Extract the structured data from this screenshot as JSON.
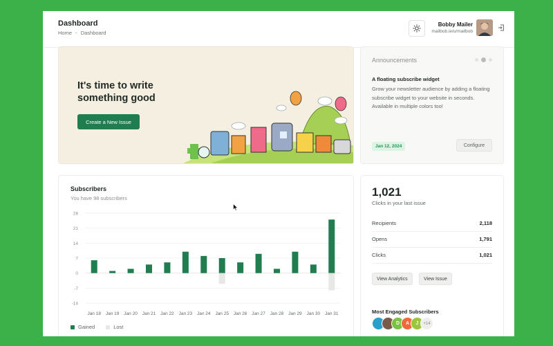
{
  "header": {
    "title": "Dashboard",
    "breadcrumb": [
      "Home",
      "-",
      "Dashboard"
    ],
    "user_name": "Bobby Mailer",
    "user_url": "mailbob.ie/u/mailbob"
  },
  "hero": {
    "line1": "It's time to write",
    "line2": "something good",
    "button_label": "Create a New Issue"
  },
  "announcements": {
    "heading": "Announcements",
    "item_title": "A floating subscribe widget",
    "item_body": "Grow your newsletter audience by adding a floating subscribe widget to your website in seconds. Available in multiple colors too!",
    "date": "Jan 12, 2024",
    "button_label": "Configure",
    "active_page": 2,
    "pages": 3
  },
  "subscribers": {
    "title": "Subscribers",
    "subtitle": "You have 98 subscribers",
    "legend_gained": "Gained",
    "legend_lost": "Lost"
  },
  "chart_data": {
    "type": "bar",
    "categories": [
      "Jan 18",
      "Jan 19",
      "Jan 20",
      "Jan 21",
      "Jan 22",
      "Jan 23",
      "Jan 24",
      "Jan 25",
      "Jan 26",
      "Jan 27",
      "Jan 28",
      "Jan 29",
      "Jan 30",
      "Jan 31"
    ],
    "series": [
      {
        "name": "Gained",
        "values": [
          6,
          1,
          2,
          4,
          5,
          10,
          8,
          7,
          5,
          9,
          2,
          10,
          4,
          25
        ]
      },
      {
        "name": "Lost",
        "values": [
          0,
          0,
          0,
          0,
          0,
          0,
          0,
          -5,
          0,
          0,
          0,
          0,
          0,
          -8
        ]
      }
    ],
    "yticks": [
      28,
      21,
      14,
      7,
      0,
      -7,
      -14
    ],
    "ylim": [
      -14,
      28
    ],
    "grid": true,
    "legend": "bottom-left",
    "colors": {
      "gained": "#1f7d4f",
      "lost": "#e6e8e6"
    }
  },
  "stats": {
    "big_number": "1,021",
    "big_label": "Clicks in your last issue",
    "rows": [
      {
        "label": "Recipients",
        "value": "2,118"
      },
      {
        "label": "Opens",
        "value": "1,791"
      },
      {
        "label": "Clicks",
        "value": "1,021"
      }
    ],
    "view_analytics": "View Analytics",
    "view_issue": "View Issue",
    "engaged_title": "Most Engaged Subscribers",
    "avatars": [
      {
        "initial": "",
        "color": "#2a9fc9"
      },
      {
        "initial": "",
        "color": "#7a5a4a"
      },
      {
        "initial": "D",
        "color": "#7cc242"
      },
      {
        "initial": "A",
        "color": "#ef6a3a"
      },
      {
        "initial": "J",
        "color": "#9bc53d"
      }
    ],
    "more": "+14"
  }
}
